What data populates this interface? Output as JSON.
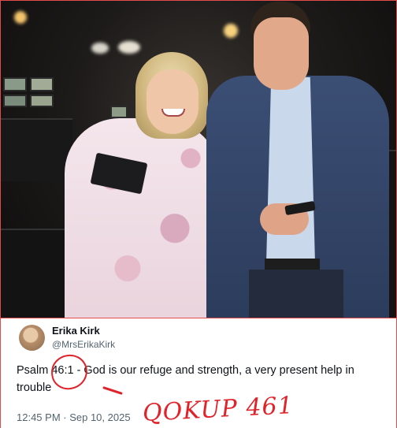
{
  "tweet": {
    "display_name": "Erika Kirk",
    "handle": "@MrsErikaKirk",
    "line1": "Psalm 46:1 - God is our refuge and strength, a very present help in",
    "line2": "trouble",
    "timestamp": "12:45 PM · Sep 10, 2025"
  },
  "annotation": {
    "handwritten_text": "QOKUP 461"
  },
  "colors": {
    "annotation_red": "#e0232a",
    "frame_red": "#e34c4c"
  }
}
